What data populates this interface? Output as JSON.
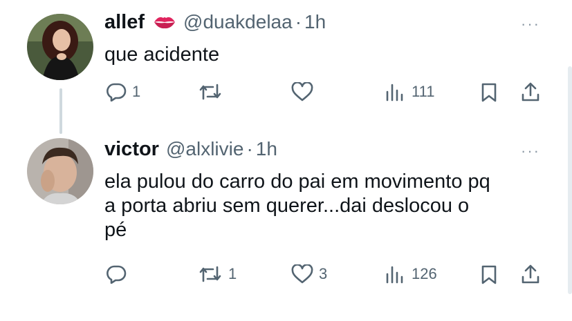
{
  "tweets": [
    {
      "name": "allef",
      "handle": "@duakdelaa",
      "separator": "·",
      "time": "1h",
      "text": "que acidente",
      "more": "···",
      "avatar_label": "allef avatar",
      "replies": "1",
      "retweets": "",
      "likes": "",
      "views": "111"
    },
    {
      "name": "victor",
      "handle": "@alxlivie",
      "separator": "·",
      "time": "1h",
      "text_lines": [
        "ela pulou do carro do pai em movimento pq",
        "a porta abriu sem querer...dai deslocou o",
        "pé"
      ],
      "more": "···",
      "avatar_label": "victor avatar",
      "replies": "",
      "retweets": "1",
      "likes": "3",
      "views": "126"
    }
  ],
  "colors": {
    "text": "#0f1419",
    "muted": "#536471",
    "thread_line": "#cfd9de",
    "kiss_emoji": "#e0245e"
  },
  "icons": [
    "reply-icon",
    "retweet-icon",
    "like-icon",
    "views-icon",
    "bookmark-icon",
    "share-icon",
    "kiss-mark-icon",
    "more-icon"
  ]
}
